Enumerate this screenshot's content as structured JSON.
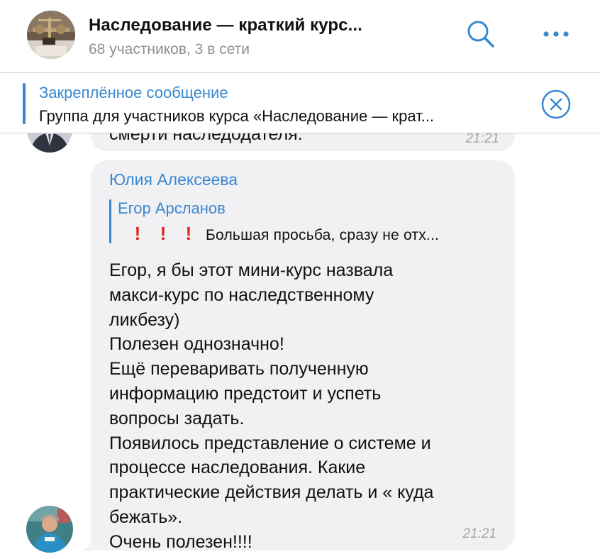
{
  "header": {
    "title": "Наследование — краткий курс...",
    "subtitle": "68 участников, 3 в сети"
  },
  "pinned": {
    "title": "Закреплённое сообщение",
    "text": "Группа для участников курса «Наследование — крат..."
  },
  "previous_message": {
    "text": "смерти наследодателя.",
    "time": "21:21"
  },
  "message": {
    "sender": "Юлия Алексеева",
    "reply": {
      "name": "Егор Арсланов",
      "text": "❗️❗️❗️ Большая просьба, сразу не отх..."
    },
    "lines": [
      "Егор, я бы этот мини-курс назвала",
      "макси-курс по наследственному",
      "ликбезу)",
      "Полезен однозначно!",
      "Ещё переваривать полученную",
      "информацию предстоит и успеть",
      "вопросы задать.",
      "Появилось представление о системе и",
      "процессе наследования. Какие",
      "практические действия делать и « куда",
      "бежать».",
      "Очень полезен!!!!"
    ],
    "time": "21:21"
  },
  "icons": {
    "search": "search-icon",
    "more": "more-icon",
    "close": "close-circle-icon"
  },
  "colors": {
    "accent": "#3a87d0",
    "bubble": "#f1f1f3",
    "secondary_text": "#8e8e93",
    "exclamation": "#e0251b"
  }
}
